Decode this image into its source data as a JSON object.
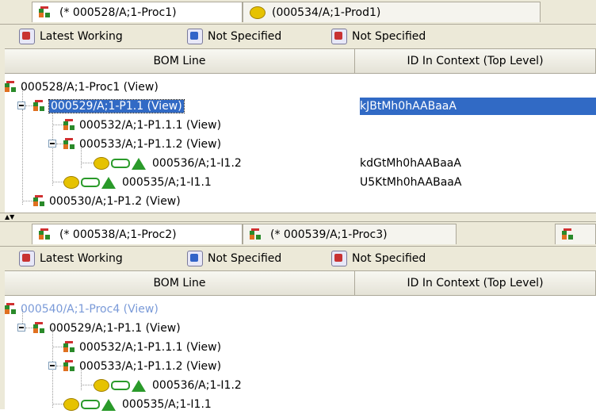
{
  "pane1": {
    "tabs": [
      {
        "label": "(* 000528/A;1-Proc1)",
        "icon": "structure-icon"
      },
      {
        "label": "(000534/A;1-Prod1)",
        "icon": "product-icon"
      }
    ],
    "toolbar": [
      {
        "label": "Latest Working",
        "icon": "revision-rule-icon"
      },
      {
        "label": "Not Specified",
        "icon": "variant-rule-icon"
      },
      {
        "label": "Not Specified",
        "icon": "effectivity-icon"
      }
    ],
    "columns": [
      "BOM Line",
      "ID In Context (Top Level)"
    ],
    "rows": [
      {
        "label": "000528/A;1-Proc1 (View)",
        "id": ""
      },
      {
        "label": "000529/A;1-P1.1 (View)",
        "id": "kJBtMh0hAABaaA"
      },
      {
        "label": "000532/A;1-P1.1.1 (View)",
        "id": ""
      },
      {
        "label": "000533/A;1-P1.1.2 (View)",
        "id": ""
      },
      {
        "label": "000536/A;1-I1.2",
        "id": "kdGtMh0hAABaaA"
      },
      {
        "label": "000535/A;1-I1.1",
        "id": "U5KtMh0hAABaaA"
      },
      {
        "label": "000530/A;1-P1.2 (View)",
        "id": ""
      }
    ]
  },
  "pane2": {
    "tabs": [
      {
        "label": "(* 000538/A;1-Proc2)",
        "icon": "structure-icon"
      },
      {
        "label": "(* 000539/A;1-Proc3)",
        "icon": "structure-icon"
      }
    ],
    "toolbar": [
      {
        "label": "Latest Working",
        "icon": "revision-rule-icon"
      },
      {
        "label": "Not Specified",
        "icon": "variant-rule-icon"
      },
      {
        "label": "Not Specified",
        "icon": "effectivity-icon"
      }
    ],
    "columns": [
      "BOM Line",
      "ID In Context (Top Level)"
    ],
    "rows": [
      {
        "label": "000540/A;1-Proc4 (View)",
        "id": ""
      },
      {
        "label": "000529/A;1-P1.1 (View)",
        "id": ""
      },
      {
        "label": "000532/A;1-P1.1.1 (View)",
        "id": ""
      },
      {
        "label": "000533/A;1-P1.1.2 (View)",
        "id": ""
      },
      {
        "label": "000536/A;1-I1.2",
        "id": ""
      },
      {
        "label": "000535/A;1-I1.1",
        "id": ""
      }
    ]
  },
  "colors": {
    "selection": "#316ac5",
    "root_link": "#7a9ad8",
    "chrome": "#ece9d8"
  }
}
